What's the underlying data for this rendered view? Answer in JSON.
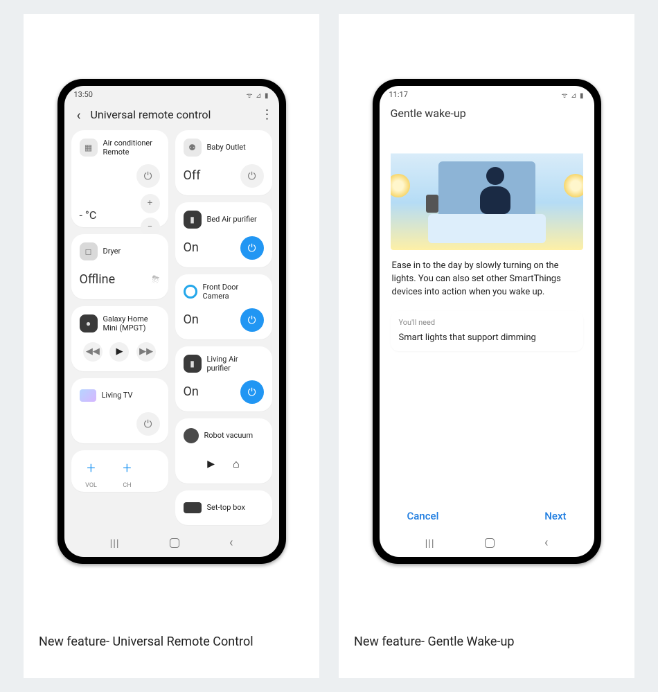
{
  "captions": {
    "left": "New feature- Universal Remote Control",
    "right": "New feature- Gentle Wake-up"
  },
  "left": {
    "status": {
      "time": "13:50",
      "icons": "ᯤ ⊿ ▮"
    },
    "header": {
      "title": "Universal remote control"
    },
    "devices": {
      "ac": {
        "label": "Air conditioner Remote",
        "temp": "- °C"
      },
      "baby": {
        "label": "Baby Outlet",
        "state": "Off"
      },
      "bedair": {
        "label": "Bed Air purifier",
        "state": "On"
      },
      "dryer": {
        "label": "Dryer",
        "state": "Offline"
      },
      "frontdoor": {
        "label": "Front Door Camera",
        "state": "On"
      },
      "galaxy": {
        "label": "Galaxy Home Mini (MPGT)"
      },
      "livingair": {
        "label": "Living Air purifier",
        "state": "On"
      },
      "livingtv": {
        "label": "Living TV"
      },
      "robot": {
        "label": "Robot vacuum"
      },
      "vol": {
        "label": "VOL"
      },
      "ch": {
        "label": "CH"
      },
      "stb": {
        "label": "Set-top box"
      }
    }
  },
  "right": {
    "status": {
      "time": "11:17",
      "icons": "ᯤ ⊿ ▮"
    },
    "title": "Gentle wake-up",
    "description": "Ease in to the day by slowly turning on the lights. You can also set other SmartThings devices into action when you wake up.",
    "need_head": "You'll need",
    "need_body": "Smart lights that support dimming",
    "cancel": "Cancel",
    "next": "Next"
  }
}
